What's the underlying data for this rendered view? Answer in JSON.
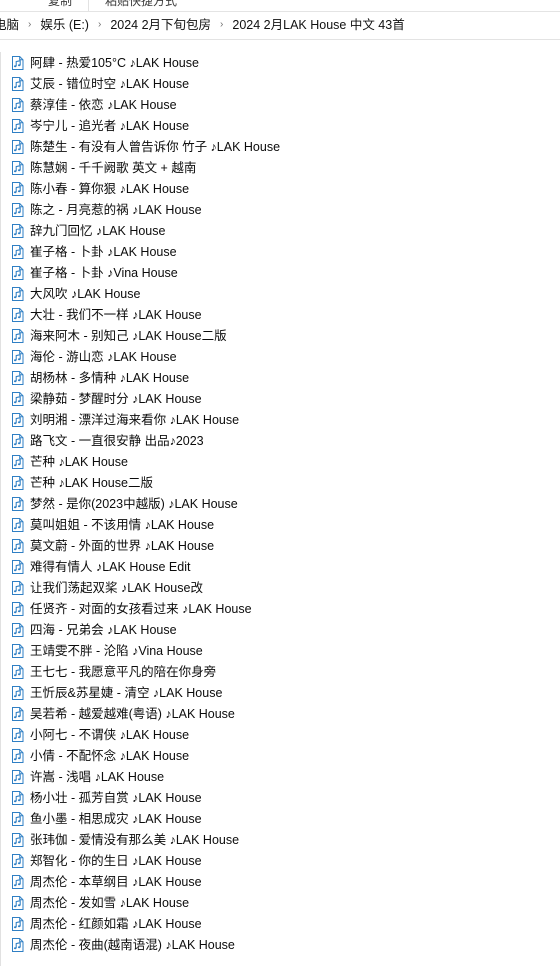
{
  "window": {
    "type": "file-explorer",
    "background": "#ffffff",
    "accent": "#1d7ec2"
  },
  "ribbon": {
    "visible_fragment": true,
    "buttons": [
      {
        "label": "复制",
        "name": "copy"
      },
      {
        "label": "粘贴快捷方式",
        "name": "paste-shortcut"
      }
    ]
  },
  "addressbar": {
    "name": "breadcrumb-bar",
    "crumbs": [
      {
        "label": "电脑",
        "clipped": true
      },
      {
        "label": "娱乐 (E:)"
      },
      {
        "label": "2024 2月下旬包房"
      },
      {
        "label": "2024 2月LAK House 中文 43首"
      }
    ],
    "separator": "›"
  },
  "filelist": {
    "name": "file-list",
    "view": "list",
    "icon_name": "music-file-icon",
    "icon_color": "#2f7fc4",
    "items": [
      {
        "name": "阿肆 - 热爱105°C ♪LAK House"
      },
      {
        "name": "艾辰 - 错位时空 ♪LAK House"
      },
      {
        "name": "蔡淳佳 - 依恋 ♪LAK House"
      },
      {
        "name": "岑宁儿 - 追光者 ♪LAK House"
      },
      {
        "name": "陈楚生 - 有没有人曾告诉你 竹子 ♪LAK House"
      },
      {
        "name": "陈慧娴 - 千千阙歌 英文 + 越南"
      },
      {
        "name": "陈小春 - 算你狠 ♪LAK House"
      },
      {
        "name": "陈之 - 月亮惹的祸 ♪LAK House"
      },
      {
        "name": "辞九门回忆 ♪LAK House"
      },
      {
        "name": "崔子格 - 卜卦 ♪LAK House"
      },
      {
        "name": "崔子格 - 卜卦 ♪Vina House"
      },
      {
        "name": "大风吹 ♪LAK House"
      },
      {
        "name": "大壮 - 我们不一样 ♪LAK House"
      },
      {
        "name": "海来阿木 - 别知己 ♪LAK House二版"
      },
      {
        "name": "海伦 - 游山恋 ♪LAK House"
      },
      {
        "name": "胡杨林 - 多情种 ♪LAK House"
      },
      {
        "name": "梁静茹 -  梦醒时分 ♪LAK House"
      },
      {
        "name": "刘明湘 - 漂洋过海来看你 ♪LAK House"
      },
      {
        "name": "路飞文 - 一直很安静 出品♪2023"
      },
      {
        "name": "芒种 ♪LAK House"
      },
      {
        "name": "芒种 ♪LAK House二版"
      },
      {
        "name": "梦然 - 是你(2023中越版) ♪LAK House"
      },
      {
        "name": "莫叫姐姐 - 不该用情 ♪LAK House"
      },
      {
        "name": "莫文蔚 - 外面的世界 ♪LAK House"
      },
      {
        "name": "难得有情人 ♪LAK House Edit"
      },
      {
        "name": "让我们荡起双桨 ♪LAK House改"
      },
      {
        "name": "任贤齐 - 对面的女孩看过来 ♪LAK House"
      },
      {
        "name": "四海 - 兄弟会 ♪LAK House"
      },
      {
        "name": "王靖雯不胖 - 沦陷 ♪Vina House"
      },
      {
        "name": "王七七 - 我愿意平凡的陪在你身旁"
      },
      {
        "name": "王忻辰&苏星婕 - 清空 ♪LAK House"
      },
      {
        "name": "吴若希 - 越爱越难(粤语) ♪LAK House"
      },
      {
        "name": "小阿七 - 不谓侠 ♪LAK House"
      },
      {
        "name": "小倩 - 不配怀念 ♪LAK House"
      },
      {
        "name": "许嵩 - 浅唱 ♪LAK House"
      },
      {
        "name": "杨小壮 - 孤芳自赏 ♪LAK House"
      },
      {
        "name": "鱼小墨 - 相思成灾 ♪LAK House"
      },
      {
        "name": "张玮伽 - 爱情没有那么美 ♪LAK House"
      },
      {
        "name": "郑智化 - 你的生日 ♪LAK House"
      },
      {
        "name": "周杰伦 - 本草纲目 ♪LAK House"
      },
      {
        "name": "周杰伦 - 发如雪 ♪LAK House"
      },
      {
        "name": "周杰伦 - 红颜如霜 ♪LAK House"
      },
      {
        "name": "周杰伦 - 夜曲(越南语混) ♪LAK House"
      }
    ]
  }
}
